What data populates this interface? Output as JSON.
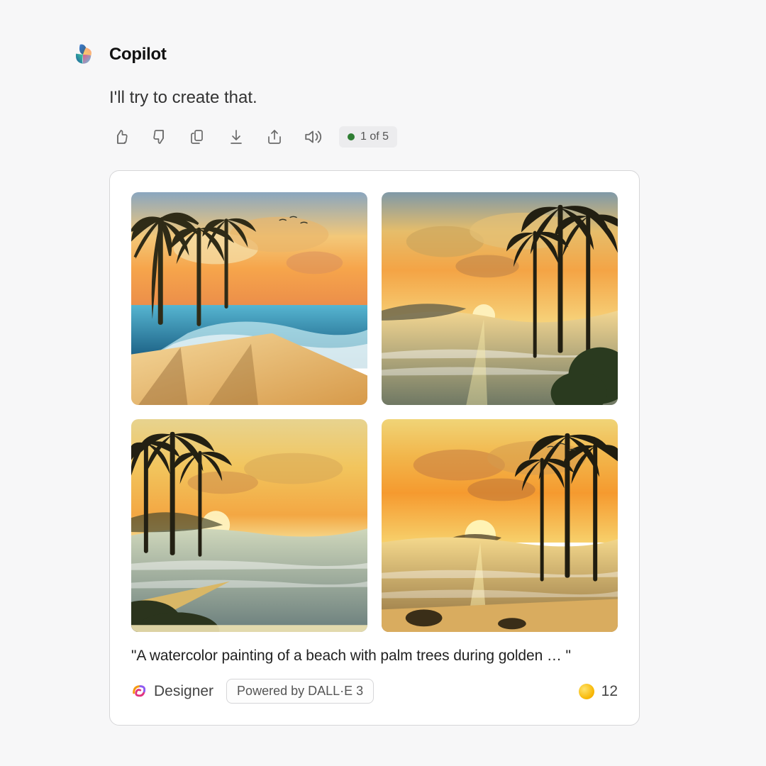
{
  "assistant": {
    "name": "Copilot",
    "message": "I'll try to create that."
  },
  "actions": {
    "like": "like-icon",
    "dislike": "dislike-icon",
    "copy": "copy-icon",
    "download": "download-icon",
    "share": "share-icon",
    "speak": "speaker-icon"
  },
  "counter": {
    "text": "1 of 5"
  },
  "card": {
    "prompt": "\"A watercolor painting of a beach with palm trees during golden …  \"",
    "designer_label": "Designer",
    "powered_by": "Powered by DALL·E 3",
    "credits": "12",
    "images": [
      {
        "alt": "Watercolor beach sunset with palm trees, bright blue waves"
      },
      {
        "alt": "Watercolor tropical cove at golden hour, tall palms, calm water"
      },
      {
        "alt": "Watercolor shoreline sunset with palm silhouettes and gentle surf"
      },
      {
        "alt": "Watercolor beach sunrise with palms and glowing sun reflection"
      }
    ]
  }
}
